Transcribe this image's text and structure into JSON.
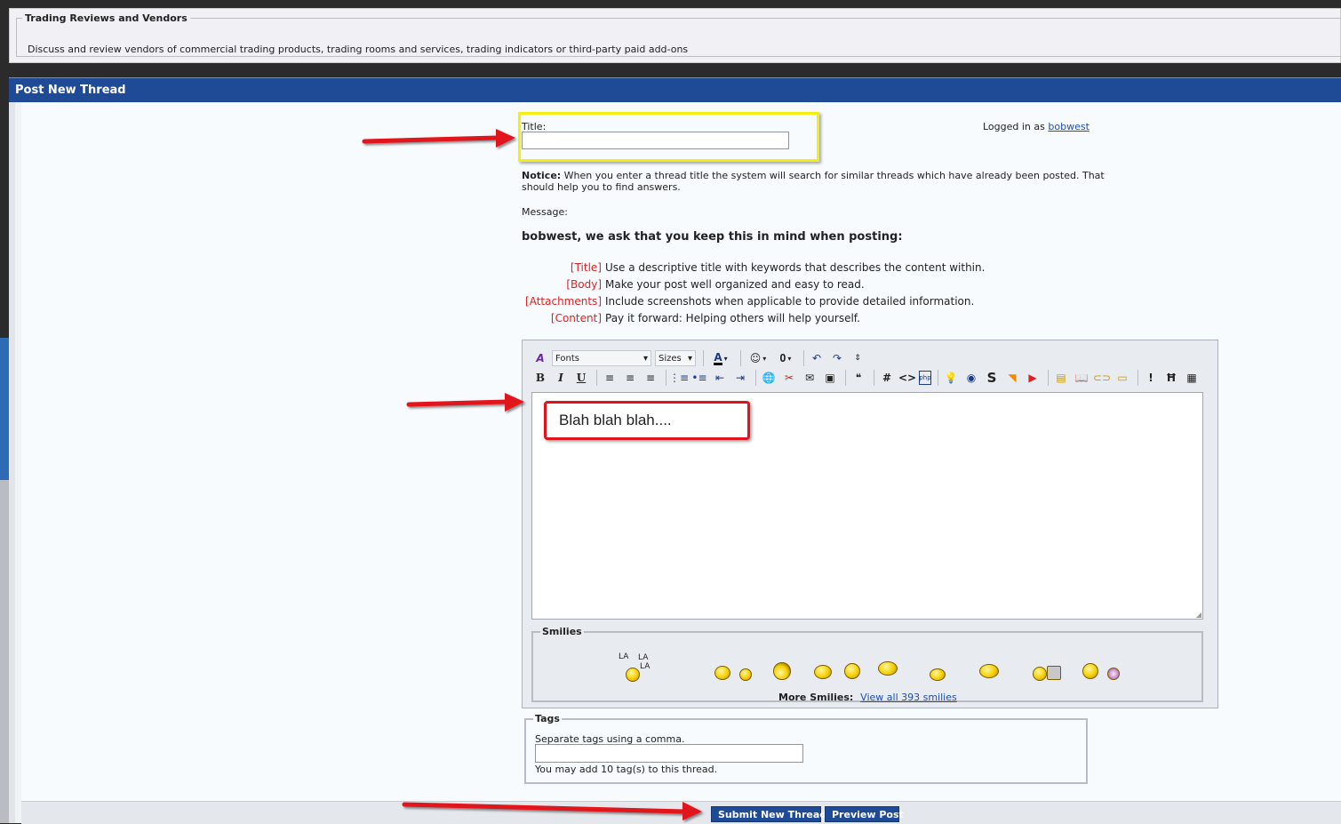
{
  "forum": {
    "name": "Trading Reviews and Vendors",
    "description": "Discuss and review vendors of commercial trading products, trading rooms and services, trading indicators or third-party paid add-ons"
  },
  "panel": {
    "title": "Post New Thread"
  },
  "form": {
    "title_label": "Title:",
    "title_value": "",
    "logged_in_prefix": "Logged in as",
    "username": "bobwest",
    "notice_bold": "Notice:",
    "notice_text": "When you enter a thread title the system will search for similar threads which have already been posted. That should help you to find answers.",
    "message_label": "Message:",
    "rules_heading": "bobwest, we ask that you keep this in mind when posting:",
    "rules": [
      {
        "tag": "[Title]",
        "text": "Use a descriptive title with keywords that describes the content within."
      },
      {
        "tag": "[Body]",
        "text": "Make your post well organized and easy to read."
      },
      {
        "tag": "[Attachments]",
        "text": "Include screenshots when applicable to provide detailed information."
      },
      {
        "tag": "[Content]",
        "text": "Pay it forward: Helping others will help yourself."
      }
    ]
  },
  "editor": {
    "fonts_label": "Fonts",
    "sizes_label": "Sizes",
    "message_text": "Blah blah blah....",
    "smilies_legend": "Smilies",
    "more_smilies_label": "More Smilies:",
    "view_all_smilies": "View all 393 smilies",
    "smiley_la_text": "LA"
  },
  "toolbar_icons": [
    "remove-format-icon",
    "font-color-icon",
    "smilie-icon",
    "attach-icon",
    "undo-icon",
    "redo-icon",
    "resize-icon",
    "bold-icon",
    "italic-icon",
    "underline-icon",
    "align-left-icon",
    "align-center-icon",
    "align-right-icon",
    "ordered-list-icon",
    "unordered-list-icon",
    "outdent-icon",
    "indent-icon",
    "link-icon",
    "unlink-icon",
    "email-icon",
    "image-icon",
    "quote-icon",
    "hash-icon",
    "code-icon",
    "php-icon",
    "spoiler-icon",
    "sound-icon",
    "strike-icon",
    "rss-icon",
    "youtube-icon",
    "media-icon",
    "book-icon",
    "chain-icon",
    "box-icon",
    "alert-icon",
    "h-icon",
    "table-icon"
  ],
  "tags": {
    "legend": "Tags",
    "help": "Separate tags using a comma.",
    "note": "You may add 10 tag(s) to this thread."
  },
  "buttons": {
    "submit": "Submit New Thread",
    "preview": "Preview Post"
  },
  "colors": {
    "header_blue": "#1f4a96",
    "annotation_red": "#e0141e",
    "annotation_yellow": "#f3ef12",
    "rule_tag_red": "#dd2222"
  }
}
